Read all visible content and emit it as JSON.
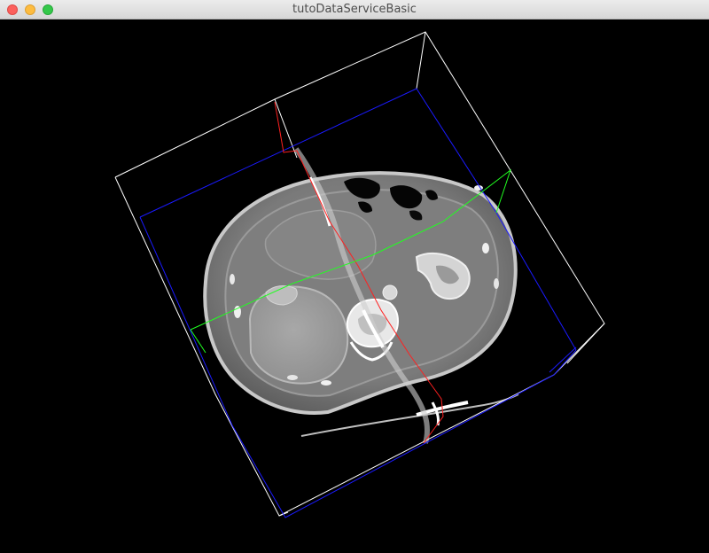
{
  "window": {
    "title": "tutoDataServiceBasic"
  },
  "controls": {
    "close": "close-button",
    "minimize": "minimize-button",
    "zoom": "zoom-button"
  },
  "scene": {
    "background": "#000000",
    "bbox_outer_color": "#ffffff",
    "bbox_inner_color": "#1a1aff",
    "axial_slice_color": "#ff2020",
    "sagittal_slice_color": "#20ff20"
  }
}
